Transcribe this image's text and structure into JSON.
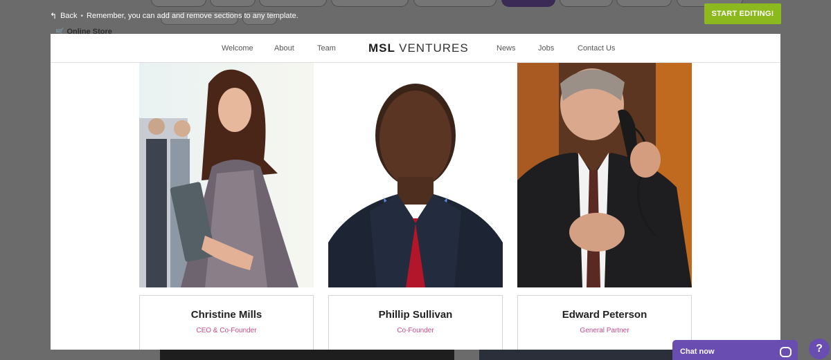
{
  "topbar": {
    "back_label": "Back",
    "separator": "•",
    "hint": "Remember, you can add and remove sections to any template.",
    "online_store": "Online Store",
    "start_editing": "START EDITING!"
  },
  "site": {
    "logo_bold": "MSL",
    "logo_rest": "VENTURES",
    "nav_left": [
      "Welcome",
      "About",
      "Team"
    ],
    "nav_right": [
      "News",
      "Jobs",
      "Contact Us"
    ]
  },
  "team": [
    {
      "name": "Christine Mills",
      "role": "CEO & Co-Founder"
    },
    {
      "name": "Phillip Sullivan",
      "role": "Co-Founder"
    },
    {
      "name": "Edward Peterson",
      "role": "General Partner"
    }
  ],
  "chat": {
    "label": "Chat now",
    "help": "?"
  },
  "colors": {
    "accent": "#8cba1e",
    "role": "#c44a8a",
    "chat": "#6a4db0"
  }
}
